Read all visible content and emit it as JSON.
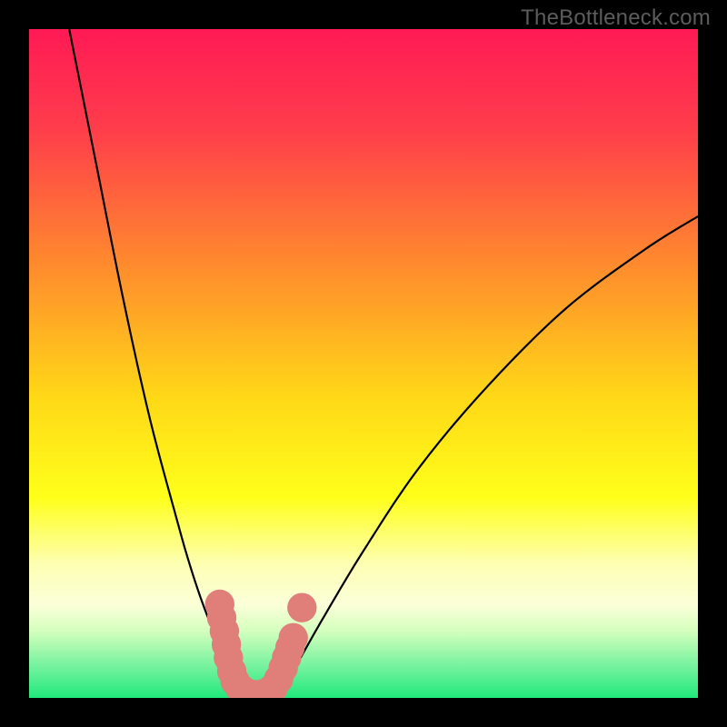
{
  "watermark": "TheBottleneck.com",
  "chart_data": {
    "type": "line",
    "title": "",
    "xlabel": "",
    "ylabel": "",
    "xlim": [
      0,
      100
    ],
    "ylim": [
      0,
      100
    ],
    "background_gradient": {
      "stops": [
        {
          "offset": 0,
          "color": "#ff1a55"
        },
        {
          "offset": 15,
          "color": "#ff3d4b"
        },
        {
          "offset": 35,
          "color": "#ff8a2e"
        },
        {
          "offset": 55,
          "color": "#ffd817"
        },
        {
          "offset": 70,
          "color": "#ffff1a"
        },
        {
          "offset": 80,
          "color": "#fdffb3"
        },
        {
          "offset": 86,
          "color": "#fcffd8"
        },
        {
          "offset": 90,
          "color": "#d4ffbe"
        },
        {
          "offset": 94,
          "color": "#8cf5a6"
        },
        {
          "offset": 100,
          "color": "#20e87c"
        }
      ]
    },
    "series": [
      {
        "name": "bottleneck-curve",
        "color": "#000000",
        "x": [
          6,
          10,
          14,
          18,
          22,
          24,
          26,
          28,
          30,
          31,
          32,
          34,
          36,
          38,
          40,
          44,
          50,
          58,
          68,
          80,
          92,
          100
        ],
        "y": [
          100,
          80,
          60,
          42,
          27,
          20,
          14,
          9,
          5,
          2,
          0,
          0,
          0,
          2,
          5,
          12,
          22,
          34,
          46,
          58,
          67,
          72
        ]
      }
    ],
    "markers": {
      "name": "highlight-dots",
      "color": "#e07f7a",
      "radius": 2.2,
      "points": [
        {
          "x": 28.5,
          "y": 14
        },
        {
          "x": 28.8,
          "y": 12
        },
        {
          "x": 29.2,
          "y": 10
        },
        {
          "x": 29.5,
          "y": 8
        },
        {
          "x": 29.8,
          "y": 6
        },
        {
          "x": 30.3,
          "y": 4
        },
        {
          "x": 30.8,
          "y": 2.5
        },
        {
          "x": 31.5,
          "y": 1.5
        },
        {
          "x": 32.5,
          "y": 0.8
        },
        {
          "x": 33.5,
          "y": 0.5
        },
        {
          "x": 34.5,
          "y": 0.5
        },
        {
          "x": 35.5,
          "y": 0.8
        },
        {
          "x": 36.5,
          "y": 1.5
        },
        {
          "x": 37.3,
          "y": 2.8
        },
        {
          "x": 38.0,
          "y": 4.5
        },
        {
          "x": 38.5,
          "y": 6.0
        },
        {
          "x": 39.0,
          "y": 7.5
        },
        {
          "x": 39.5,
          "y": 9.0
        },
        {
          "x": 40.8,
          "y": 13.5
        }
      ]
    }
  }
}
